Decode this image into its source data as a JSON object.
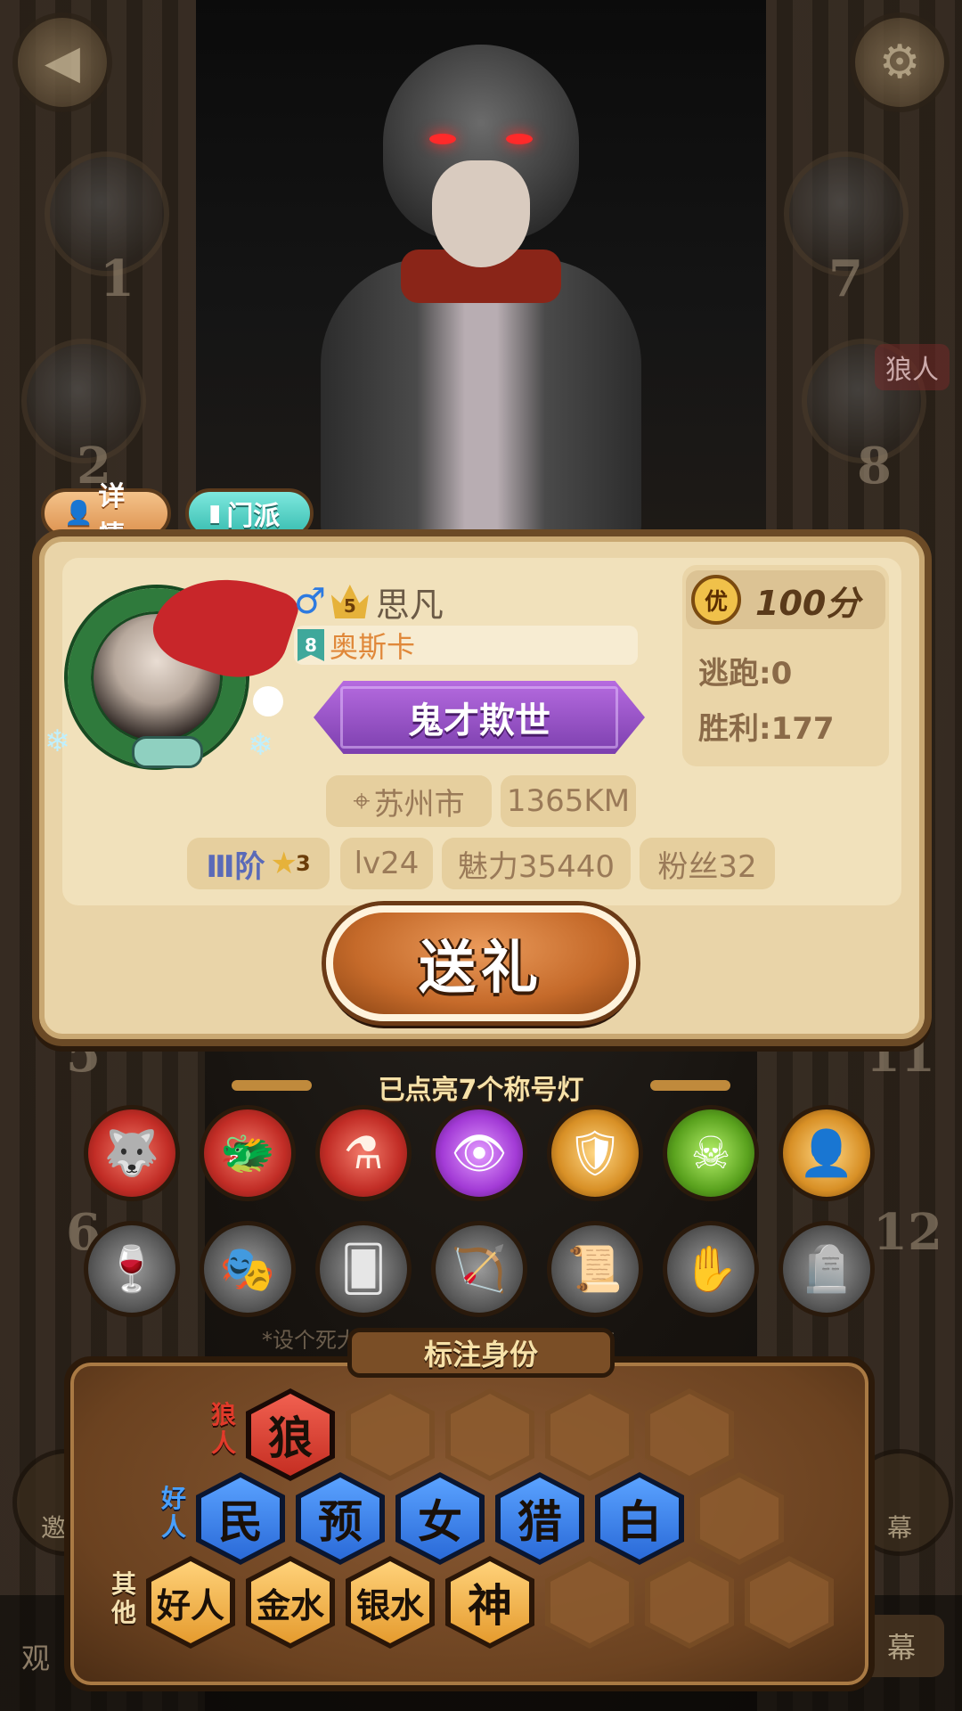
{
  "header": {
    "back_icon": "back-arrow-icon",
    "settings_icon": "gear-icon"
  },
  "seats": {
    "left": [
      "1",
      "2",
      "5",
      "6"
    ],
    "right": [
      "7",
      "8",
      "11",
      "12"
    ],
    "seat8_tag": "狼人"
  },
  "tabs": {
    "detail": "详情",
    "guild": "门派"
  },
  "profile": {
    "gender_symbol": "♂",
    "level_crown": "5",
    "name": "思凡",
    "guild_level": "8",
    "guild_name": "奥斯卡",
    "title": "鬼才欺世",
    "score_badge": "优",
    "score": "100分",
    "escape": "逃跑:0",
    "wins": "胜利:177",
    "city": "苏州市",
    "distance": "1365KM",
    "rank": "Ⅲ阶",
    "rank_star": "3",
    "level": "lv24",
    "charm": "魅力35440",
    "fans": "粉丝32",
    "gift_button": "送礼"
  },
  "lamps": {
    "heading": "已点亮7个称号灯",
    "lit": [
      "wolf-lamp-icon",
      "werewolf-lamp-icon",
      "potion-lamp-icon",
      "seer-lamp-icon",
      "shield-lamp-icon",
      "poison-lamp-icon",
      "portrait-lamp-icon"
    ],
    "unlit": [
      "cup-lamp-icon",
      "mask-lamp-icon",
      "card-lamp-icon",
      "bow-lamp-icon",
      "scroll-lamp-icon",
      "glove-lamp-icon",
      "tombstone-lamp-icon"
    ],
    "hint": "*设个死大护赛左指隐谢声你开始发言"
  },
  "identity": {
    "heading": "标注身份",
    "wolf_label": "狼人",
    "good_label": "好人",
    "other_label": "其他",
    "wolf": [
      "狼"
    ],
    "good": [
      "民",
      "预",
      "女",
      "猎",
      "白"
    ],
    "other": [
      "好人",
      "金水",
      "银水",
      "神"
    ]
  },
  "bottom": {
    "invite": "邀请",
    "watch": "观",
    "danmu": "幕",
    "danmu_side": "幕"
  },
  "colors": {
    "wolf_red": "#c52e22",
    "good_blue": "#2a6ad8",
    "other_gold": "#e59b2e",
    "title_purple": "#a33bd6"
  }
}
